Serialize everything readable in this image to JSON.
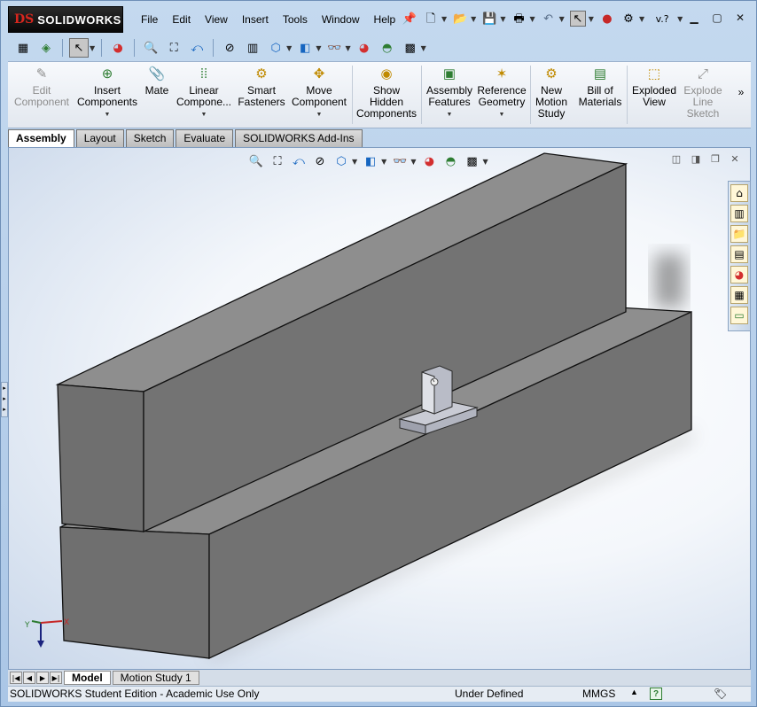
{
  "app": {
    "brand": "SOLIDWORKS",
    "logo_mark": "DS"
  },
  "menu": [
    "File",
    "Edit",
    "View",
    "Insert",
    "Tools",
    "Window",
    "Help"
  ],
  "command_manager": {
    "items": [
      {
        "label": "Edit\nComponent",
        "icon": "edit-component-icon",
        "glyph": "✎",
        "enabled": false,
        "dropdown": false
      },
      {
        "label": "Insert\nComponents",
        "icon": "insert-components-icon",
        "glyph": "⊕",
        "enabled": true,
        "dropdown": true
      },
      {
        "label": "Mate",
        "icon": "mate-icon",
        "glyph": "📎",
        "enabled": true,
        "dropdown": false
      },
      {
        "label": "Linear\nCompone...",
        "icon": "linear-pattern-icon",
        "glyph": "⁞",
        "enabled": true,
        "dropdown": true
      },
      {
        "label": "Smart\nFasteners",
        "icon": "smart-fasteners-icon",
        "glyph": "⚙",
        "enabled": true,
        "dropdown": false
      },
      {
        "label": "Move\nComponent",
        "icon": "move-component-icon",
        "glyph": "✥",
        "enabled": true,
        "dropdown": true
      },
      {
        "label": "Show\nHidden\nComponents",
        "icon": "show-hidden-icon",
        "glyph": "◉",
        "enabled": true,
        "dropdown": false
      },
      {
        "label": "Assembly\nFeatures",
        "icon": "assembly-features-icon",
        "glyph": "▣",
        "enabled": true,
        "dropdown": true
      },
      {
        "label": "Reference\nGeometry",
        "icon": "reference-geometry-icon",
        "glyph": "✶",
        "enabled": true,
        "dropdown": true
      },
      {
        "label": "New\nMotion\nStudy",
        "icon": "motion-study-icon",
        "glyph": "⚙",
        "enabled": true,
        "dropdown": false
      },
      {
        "label": "Bill of\nMaterials",
        "icon": "bom-icon",
        "glyph": "▤",
        "enabled": true,
        "dropdown": false
      },
      {
        "label": "Exploded\nView",
        "icon": "exploded-view-icon",
        "glyph": "⬚",
        "enabled": true,
        "dropdown": false
      },
      {
        "label": "Explode\nLine\nSketch",
        "icon": "explode-line-sketch-icon",
        "glyph": "⤢",
        "enabled": false,
        "dropdown": false
      }
    ]
  },
  "tabs": [
    "Assembly",
    "Layout",
    "Sketch",
    "Evaluate",
    "SOLIDWORKS Add-Ins"
  ],
  "active_tab": "Assembly",
  "bottom_tabs": [
    "Model",
    "Motion Study 1"
  ],
  "active_bottom_tab": "Model",
  "status": {
    "edition": "SOLIDWORKS Student Edition - Academic Use Only",
    "state": "Under Defined",
    "units": "MMGS"
  },
  "triad": {
    "x": "X",
    "y": "Y"
  },
  "title_tools": {
    "search_prefix": "v."
  }
}
